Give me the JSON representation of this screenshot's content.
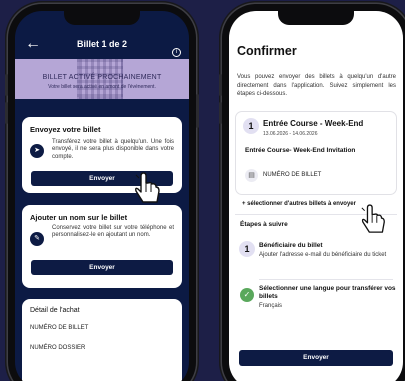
{
  "left_screen": {
    "header": {
      "title": "Billet 1 de 2"
    },
    "banner": {
      "title": "BILLET ACTIVÉ PROCHAINEMENT",
      "subtitle": "Votre billet sera activé en amont de l'événement."
    },
    "send_card": {
      "title": "Envoyez votre billet",
      "text": "Transférez votre billet à quelqu'un. Une fois envoyé, il ne sera plus disponible dans votre compte.",
      "button": "Envoyer"
    },
    "name_card": {
      "title": "Ajouter un nom sur le billet",
      "text": "Conservez votre billet sur votre téléphone et personnalisez-le en ajoutant un nom.",
      "button": "Envoyer"
    },
    "detail_card": {
      "title": "Détail de l'achat",
      "rows": [
        "NUMÉRO DE BILLET",
        "NUMÉRO DOSSIER"
      ]
    }
  },
  "right_screen": {
    "title": "Confirmer",
    "intro": "Vous pouvez envoyer des billets à quelqu'un d'autre directement dans l'application. Suivez simplement les étapes ci-dessous.",
    "ticket": {
      "number": "1",
      "name": "Entrée Course - Week-End",
      "dates": "13.06.2026 - 14.06.2026",
      "invitation": "Entrée Course- Week-End Invitation",
      "ticket_label": "NUMÉRO DE BILLET"
    },
    "select_more": "+ sélectionner d'autres billets à envoyer",
    "steps": {
      "title": "Étapes à suivre",
      "items": [
        {
          "number": "1",
          "title": "Bénéficiaire du billet",
          "desc": "Ajouter l'adresse e-mail du bénéficiaire du ticket"
        },
        {
          "title": "Sélectionner une langue pour transférer vos billets",
          "desc": "Français"
        }
      ]
    },
    "button": "Envoyer"
  },
  "icons": {
    "back": "arrow-left-icon",
    "info": "info-icon",
    "send": "send-arrow-icon",
    "edit": "pencil-icon",
    "ticket": "ticket-icon",
    "check": "check-icon",
    "pointer": "hand-pointer-icon"
  },
  "colors": {
    "background": "#1d1f47",
    "dark_screen": "#0c1a44",
    "banner": "#b5a6d6",
    "button": "#0d1b44",
    "success": "#5aa85c"
  }
}
